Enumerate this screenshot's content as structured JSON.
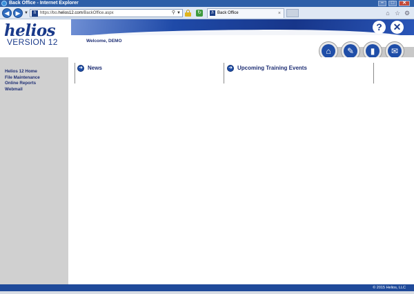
{
  "window": {
    "title": "Back Office - Internet Explorer",
    "minimize": "–",
    "maximize": "□",
    "close": "✕"
  },
  "browser": {
    "url_prefix": "https://bo.",
    "url_host": "helios12.com",
    "url_path": "/BackOffice.aspx",
    "tab_title": "Back Office",
    "favicon_letter": "h"
  },
  "header": {
    "logo_text": "helios",
    "version_text": "VERSION 12",
    "welcome": "Welcome, DEMO",
    "help_label": "?",
    "close_label": "✕"
  },
  "sidebar": {
    "items": [
      {
        "label": "Helios 12 Home"
      },
      {
        "label": "File Maintenance"
      },
      {
        "label": "Online Reports"
      },
      {
        "label": "Webmail"
      }
    ]
  },
  "main": {
    "panels": [
      {
        "title": "News"
      },
      {
        "title": "Upcoming Training Events"
      }
    ]
  },
  "footer": {
    "copyright": "© 2015 Helios, LLC"
  },
  "icons": {
    "home": "home-icon",
    "maintenance": "wrench-icon",
    "reports": "bar-chart-icon",
    "mail": "envelope-icon"
  }
}
